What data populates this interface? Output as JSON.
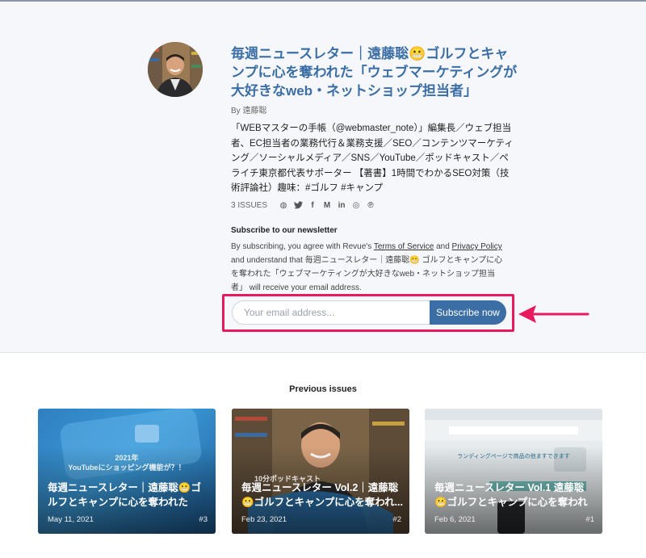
{
  "newsletter": {
    "title": "毎週ニュースレター｜遠藤聡😬ゴルフとキャンプに心を奪われた「ウェブマーケティングが大好きなweb・ネットショップ担当者」",
    "byline": "By 遠藤聡",
    "description": "「WEBマスターの手帳（@webmaster_note）」編集長／ウェブ担当者、EC担当者の業務代行＆業務支援／SEO／コンテンツマーケティング／ソーシャルメディア／SNS／YouTube／ポッドキャスト／ペライチ東京都代表サポーター 【著書】1時間でわかるSEO対策（技術評論社）趣味：#ゴルフ #キャンプ",
    "issues_count": "3 ISSUES",
    "social_icons": [
      {
        "name": "globe-icon",
        "glyph": "◍"
      },
      {
        "name": "twitter-icon",
        "glyph": "🐦"
      },
      {
        "name": "facebook-icon",
        "glyph": "f"
      },
      {
        "name": "medium-icon",
        "glyph": "M"
      },
      {
        "name": "linkedin-icon",
        "glyph": "in"
      },
      {
        "name": "instagram-icon",
        "glyph": "◎"
      },
      {
        "name": "pinterest-icon",
        "glyph": "℗"
      }
    ]
  },
  "subscribe": {
    "heading": "Subscribe to our newsletter",
    "text_1": "By subscribing, you agree with Revue's ",
    "terms": "Terms of Service",
    "text_and": " and ",
    "privacy": "Privacy Policy",
    "text_2": " and understand that 毎週ニュースレター｜遠藤聡😬 ゴルフとキャンプに心を奪われた「ウェブマーケティングが大好きなweb・ネットショップ担当者」 will receive your email address.",
    "email_placeholder": "Your email address...",
    "button_label": "Subscribe now"
  },
  "previous": {
    "heading": "Previous issues",
    "cards": [
      {
        "title": "毎週ニュースレター｜遠藤聡😬ゴルフとキャンプに心を奪われた「ウ...",
        "date": "May 11, 2021",
        "number": "#3",
        "overlay_1": "2021年",
        "overlay_2": "YouTubeにショッピング機能が？！"
      },
      {
        "title": "毎週ニュースレター Vol.2｜遠藤聡😬ゴルフとキャンプに心を奪われ...",
        "date": "Feb 23, 2021",
        "number": "#2",
        "overlay_1": "10分ポッドキャスト"
      },
      {
        "title": "毎週ニュースレター Vol.1 遠藤聡😬ゴルフとキャンプに心を奪われた...",
        "date": "Feb 6, 2021",
        "number": "#1",
        "overlay_1": "ランディングページで商品の他ますできます"
      }
    ]
  },
  "colors": {
    "accent": "#3b6ea5",
    "highlight": "#e8195d"
  }
}
